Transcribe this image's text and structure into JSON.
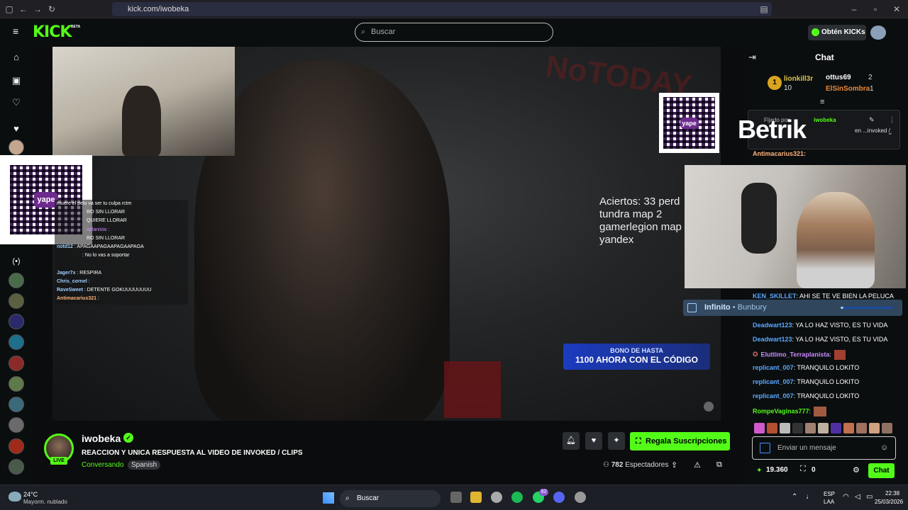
{
  "browser": {
    "url": "kick.com/iwobeka"
  },
  "header": {
    "logo": "KICK",
    "logo_badge": "BETA",
    "search_placeholder": "Buscar",
    "kicks_label": "Obtén KICKs"
  },
  "video": {
    "overlay_chat": [
      {
        "user": "",
        "text": "muere el pelu va ser tu culpa rctm"
      },
      {
        "user": "",
        "text": "RO SIN LLORAR"
      },
      {
        "user": "",
        "text": "QUIERE LLORAR"
      },
      {
        "user": "",
        "text": "aplanista :"
      },
      {
        "user": "",
        "text": "RO SIN LLORAR"
      },
      {
        "user": "notd12",
        "text": ": APAGAAPAGAAPAGAAPAGA"
      },
      {
        "user": "",
        "text": ": No lo vas a soportar"
      },
      {
        "user": "",
        "text": ""
      },
      {
        "user": "Jager7x",
        "text": ": RESPIRA"
      },
      {
        "user": "Chris_cornel",
        "text": ":"
      },
      {
        "user": "RaveSweet",
        "text": ": DETENTE GOKUUUUUUUU"
      },
      {
        "user": "Antimacarius321",
        "text": ":"
      }
    ],
    "aciertos_lines": [
      "Aciertos: 33 perd",
      "tundra map 2",
      "gamerlegion map",
      "yandex"
    ],
    "banner_line1": "BONO DE HASTA",
    "banner_line2": "1100 AHORA CON EL CÓDIGO",
    "qr_brand": "yape"
  },
  "chat": {
    "title": "Chat",
    "leaderboard": [
      {
        "rank": "1",
        "name": "lionkill3r",
        "count": "10"
      },
      {
        "name": "ottus69",
        "count": "2"
      },
      {
        "name": "ElSinSombra",
        "count": "1"
      }
    ],
    "pinned_by_label": "Fijado por",
    "pinned_user": "iwobeka",
    "pinned_text": "en ...invoked /",
    "pinned_overlay_brand": "Betrik",
    "antim_line": "Antimacarius321:",
    "music_player": {
      "song": "Infinito",
      "artist": "Bunbury",
      "progress_pct": 5
    },
    "messages": [
      {
        "user": "KEN_SKILLET",
        "text": ": AHI SE TE VE BIEN LA PELUCA",
        "color": "#5aa7ff"
      },
      {
        "user": "Deadwart123",
        "text": ": YA LO HAZ VISTO, ES TU VIDA",
        "color": "#5aa7ff"
      },
      {
        "user": "Deadwart123",
        "text": ": YA LO HAZ VISTO, ES TU VIDA",
        "color": "#5aa7ff"
      },
      {
        "user": "Eluttimo_Terraplanista",
        "text": ":",
        "color": "#c98bff"
      },
      {
        "user": "replicant_007",
        "text": ": TRANQUILO LOKITO",
        "color": "#5aa7ff"
      },
      {
        "user": "replicant_007",
        "text": ": TRANQUILO LOKITO",
        "color": "#5aa7ff"
      },
      {
        "user": "replicant_007",
        "text": ": TRANQUILO LOKITO",
        "color": "#5aa7ff"
      },
      {
        "user": "RompeVaginas777",
        "text": ":",
        "color": "#53fc18"
      }
    ],
    "input_placeholder": "Enviar un mensaje",
    "points": "19.360",
    "gifts": "0",
    "send_label": "Chat"
  },
  "stream": {
    "name": "iwobeka",
    "live_label": "LIVE",
    "title": "REACCION Y UNICA RESPUESTA AL VIDEO DE INVOKED / CLIPS",
    "category": "Conversando",
    "language": "Spanish",
    "subscribe_label": "Regala Suscripciones",
    "viewers_count": "782",
    "viewers_label": "Espectadores"
  },
  "taskbar": {
    "weather_temp": "24°C",
    "weather_desc": "Mayorm. nublado",
    "search_label": "Buscar",
    "lang_top": "ESP",
    "lang_bottom": "LAA",
    "time": "22:38",
    "date": "25/03/2026",
    "whatsapp_badge": "82"
  }
}
